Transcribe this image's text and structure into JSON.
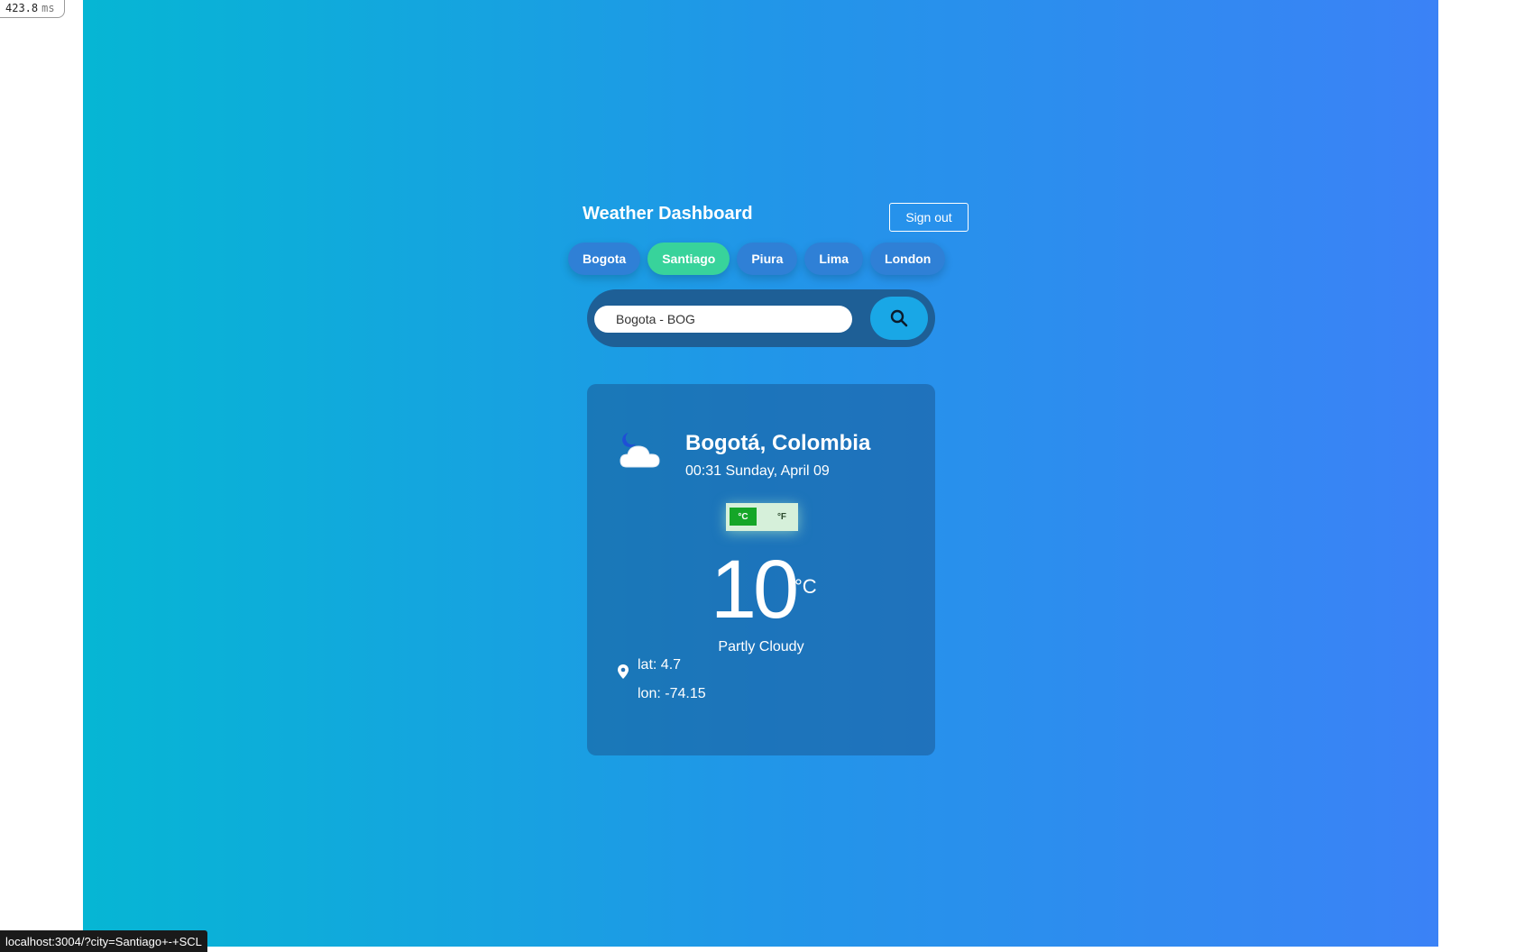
{
  "perf": {
    "value": "423.8",
    "unit": "ms"
  },
  "header": {
    "title": "Weather Dashboard",
    "signout_label": "Sign out"
  },
  "city_tabs": [
    {
      "label": "Bogota",
      "active": false
    },
    {
      "label": "Santiago",
      "active": true
    },
    {
      "label": "Piura",
      "active": false
    },
    {
      "label": "Lima",
      "active": false
    },
    {
      "label": "London",
      "active": false
    }
  ],
  "search": {
    "value": "Bogota - BOG",
    "button_icon": "search-icon"
  },
  "weather": {
    "icon": "partly-cloudy-night-icon",
    "city": "Bogotá, Colombia",
    "datetime": "00:31 Sunday, April 09",
    "unit_toggle": {
      "celsius": "°C",
      "fahrenheit": "°F",
      "selected": "°C"
    },
    "temperature": "10",
    "temperature_unit": "°C",
    "condition": "Partly Cloudy",
    "lat": "lat: 4.7",
    "lon": "lon: -74.15"
  },
  "status_bar": {
    "url": "localhost:3004/?city=Santiago+-+SCL"
  },
  "colors": {
    "gradient_start": "#06b6d4",
    "gradient_end": "#3b82f6",
    "active_tab": "#38d39b",
    "tab": "#2f80d6",
    "toggle_active": "#15a628"
  }
}
